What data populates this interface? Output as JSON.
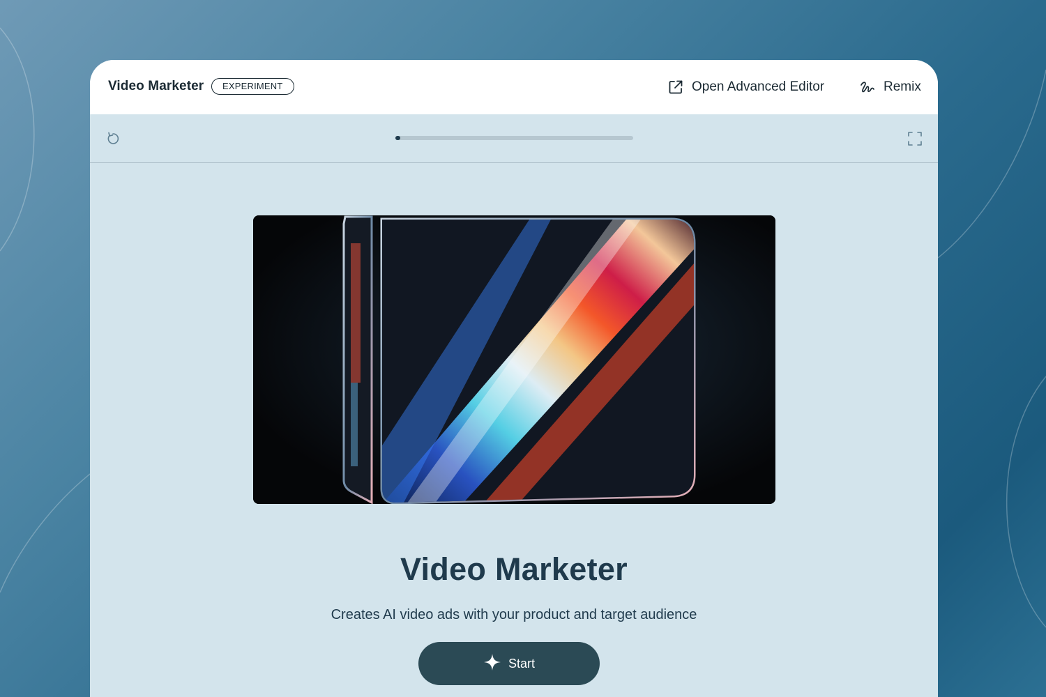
{
  "header": {
    "app_title": "Video Marketer",
    "badge": "EXPERIMENT",
    "open_editor_label": "Open Advanced Editor",
    "remix_label": "Remix"
  },
  "toolbar": {
    "progress": 0.02
  },
  "main": {
    "title": "Video Marketer",
    "subtitle": "Creates AI video ads with your product and target audience",
    "start_label": "Start"
  },
  "colors": {
    "accent_dark": "#2b4a55",
    "title_text": "#1f3a4c",
    "panel_bg": "#d3e4ec",
    "header_bg": "#ffffff"
  },
  "icons": {
    "open_editor": "external-link-icon",
    "remix": "remix-icon",
    "reload": "reload-icon",
    "fullscreen": "fullscreen-icon",
    "start": "sparkle-icon"
  }
}
